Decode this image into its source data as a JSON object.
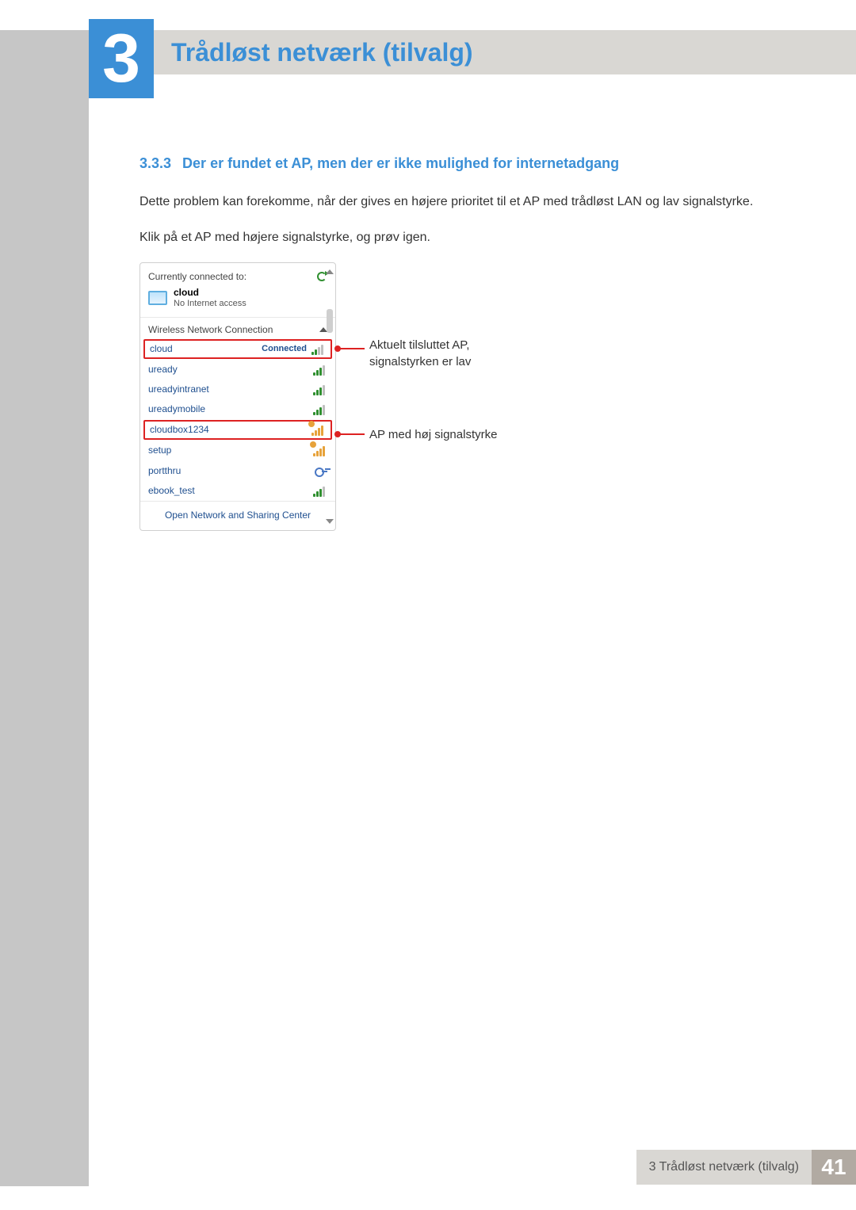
{
  "chapter": {
    "number": "3",
    "title": "Trådløst netværk (tilvalg)"
  },
  "section": {
    "number": "3.3.3",
    "title": "Der er fundet et AP, men der er ikke mulighed for internetadgang"
  },
  "paragraphs": {
    "p1": "Dette problem kan forekomme, når der gives en højere prioritet til et AP med trådløst LAN og lav signalstyrke.",
    "p2": "Klik på et AP med højere signalstyrke, og prøv igen."
  },
  "wifi": {
    "header": "Currently connected to:",
    "connected_name": "cloud",
    "connected_status": "No Internet access",
    "section_label": "Wireless Network Connection",
    "connected_label": "Connected",
    "networks": [
      {
        "name": "cloud",
        "signal": "low",
        "connected": true,
        "highlight": true
      },
      {
        "name": "uready",
        "signal": "med"
      },
      {
        "name": "ureadyintranet",
        "signal": "med"
      },
      {
        "name": "ureadymobile",
        "signal": "med"
      },
      {
        "name": "cloudbox1234",
        "signal": "high-orange",
        "highlight": true
      },
      {
        "name": "setup",
        "signal": "high-orange"
      },
      {
        "name": "portthru",
        "signal": "key"
      },
      {
        "name": "ebook_test",
        "signal": "med"
      }
    ],
    "open_center": "Open Network and Sharing Center"
  },
  "callouts": {
    "c1_line1": "Aktuelt tilsluttet AP,",
    "c1_line2": "signalstyrken er lav",
    "c2": "AP med høj signalstyrke"
  },
  "footer": {
    "text": "3 Trådløst netværk (tilvalg)",
    "page": "41"
  }
}
